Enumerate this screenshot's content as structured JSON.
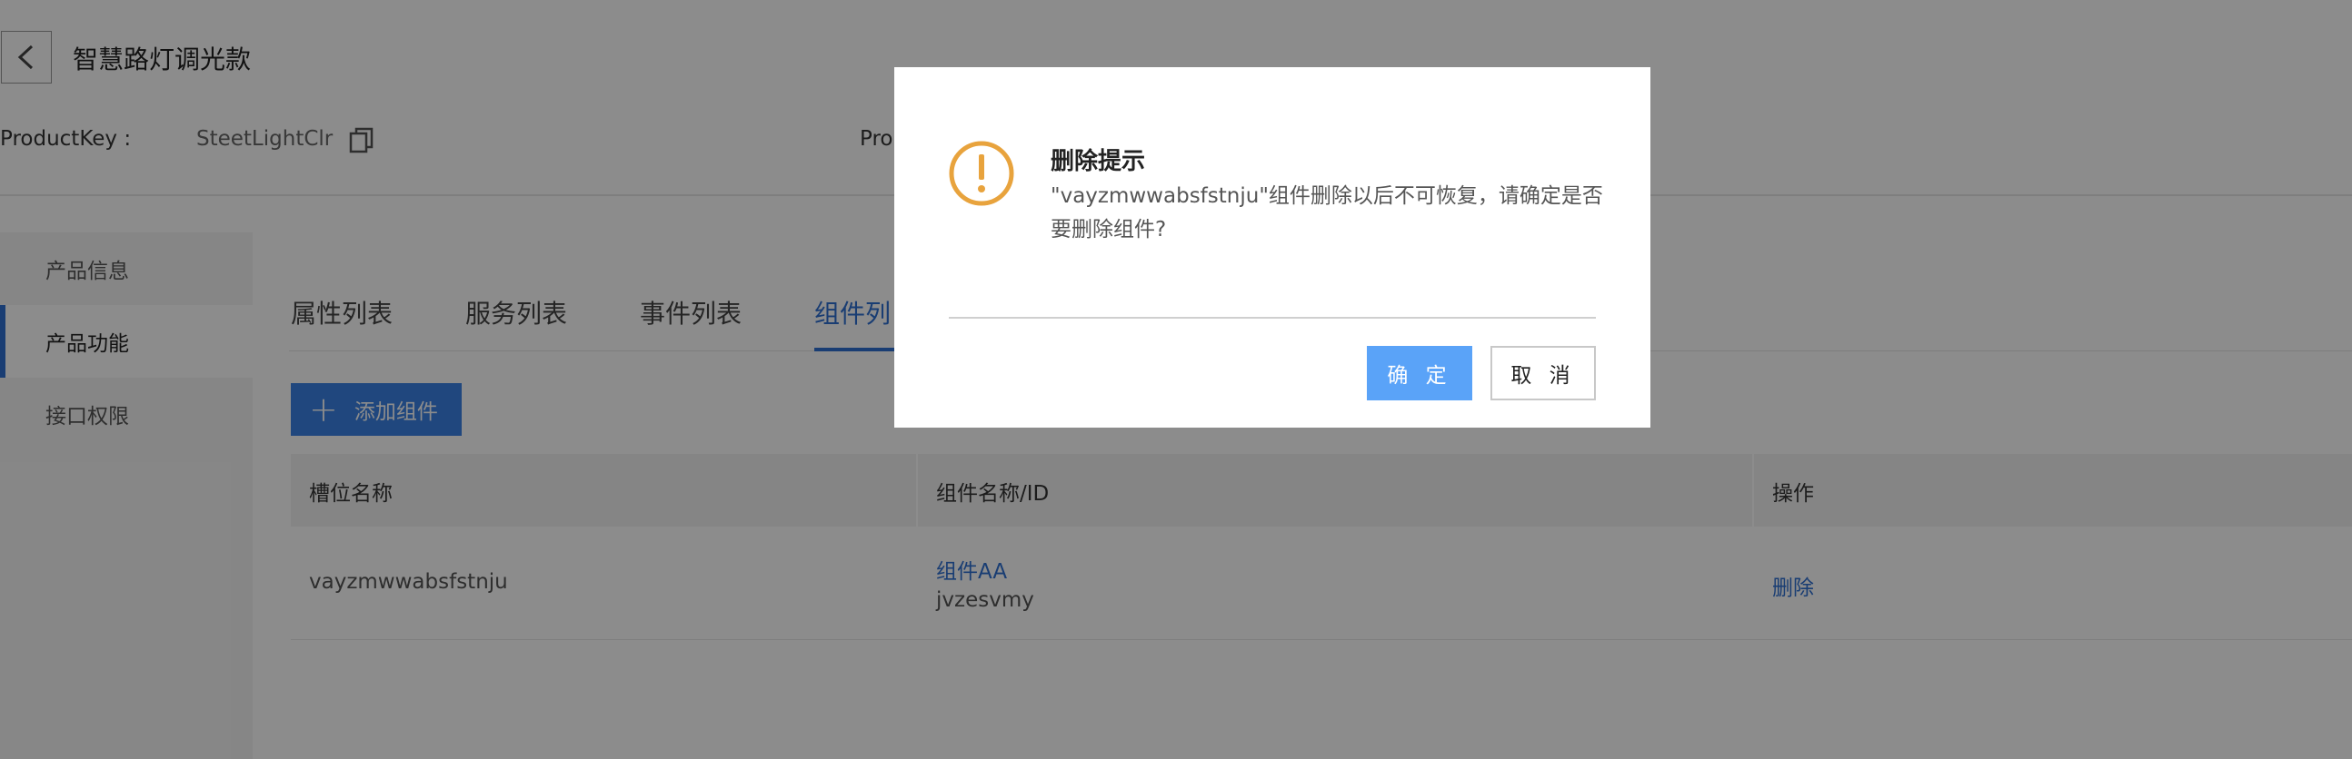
{
  "header": {
    "title": "智慧路灯调光款",
    "product_key_label": "ProductKey :",
    "product_key_value": "SteetLightClr",
    "second_label_partial": "Pro"
  },
  "sidebar": {
    "items": [
      {
        "label": "产品信息",
        "active": false
      },
      {
        "label": "产品功能",
        "active": true
      },
      {
        "label": "接口权限",
        "active": false
      }
    ]
  },
  "tabs": [
    {
      "label": "属性列表",
      "active": false
    },
    {
      "label": "服务列表",
      "active": false
    },
    {
      "label": "事件列表",
      "active": false
    },
    {
      "label": "组件列",
      "active": true
    }
  ],
  "toolbar": {
    "add_label": "添加组件",
    "add_icon": "plus-icon"
  },
  "table": {
    "columns": [
      "槽位名称",
      "组件名称/ID",
      "操作"
    ],
    "rows": [
      {
        "slot": "vayzmwwabsfstnju",
        "component_name": "组件AA",
        "component_id": "jvzesvmy",
        "action": "删除"
      }
    ]
  },
  "dialog": {
    "title": "删除提示",
    "message": "\"vayzmwwabsfstnju\"组件删除以后不可恢复，请确定是否要删除组件?",
    "confirm_label": "确 定",
    "cancel_label": "取 消",
    "icon": "warning-icon"
  },
  "colors": {
    "accent": "#2f6fd1",
    "warning": "#e8a33d",
    "confirm": "#5aa3f8",
    "overlay": "rgba(0,0,0,0.45)"
  }
}
